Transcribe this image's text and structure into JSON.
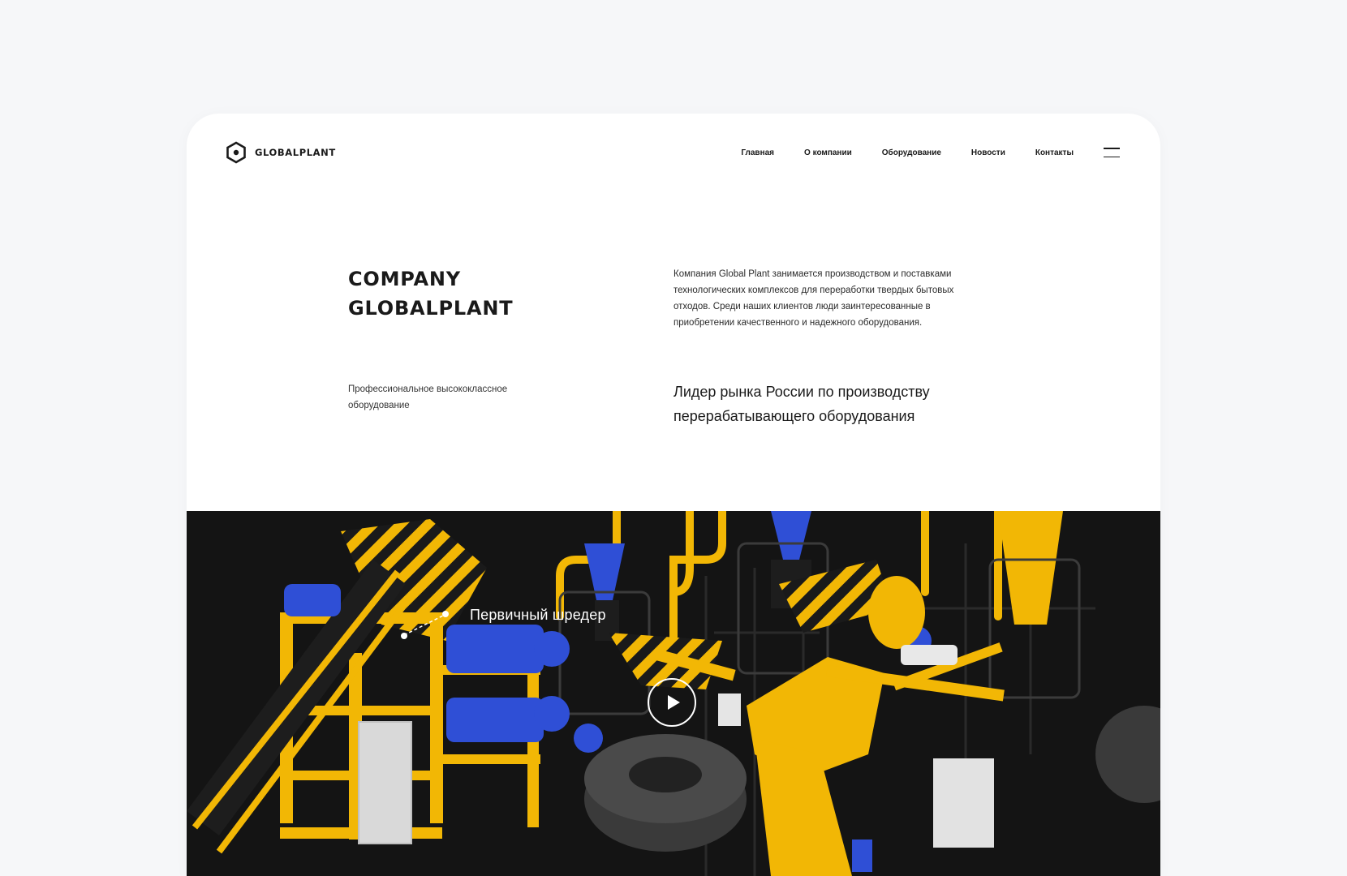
{
  "header": {
    "logo_text": "GLOBALPLANT",
    "nav": [
      "Главная",
      "О компании",
      "Оборудование",
      "Новости",
      "Контакты"
    ]
  },
  "hero": {
    "title_line1": "COMPANY",
    "title_line2": "GLOBALPLANT",
    "description": "Компания Global Plant занимается производством и поставками технологических комплексов для переработки твердых бытовых отходов. Среди наших клиентов люди заинтересованные в приобретении  качественного и надежного оборудования.",
    "subtitle": "Профессиональное высококлассное оборудование",
    "lead": "Лидер рынка России по производству перерабатывающего оборудования"
  },
  "media": {
    "callout_label": "Первичный шредер",
    "colors": {
      "yellow": "#f2b705",
      "blue": "#2f4fd6",
      "dark": "#141414",
      "tire": "#3a3a3a"
    }
  }
}
